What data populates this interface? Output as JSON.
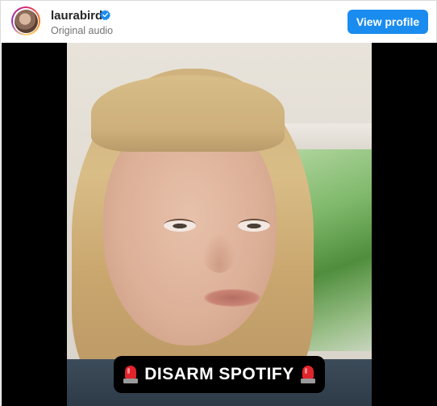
{
  "header": {
    "username": "laurabird",
    "subtitle": "Original audio",
    "view_profile_label": "View profile",
    "verified_icon": "verified-badge-icon",
    "accent_color": "#1a8cf0"
  },
  "video": {
    "caption": "DISARM SPOTIFY",
    "caption_icon": "police-light-emoji"
  }
}
